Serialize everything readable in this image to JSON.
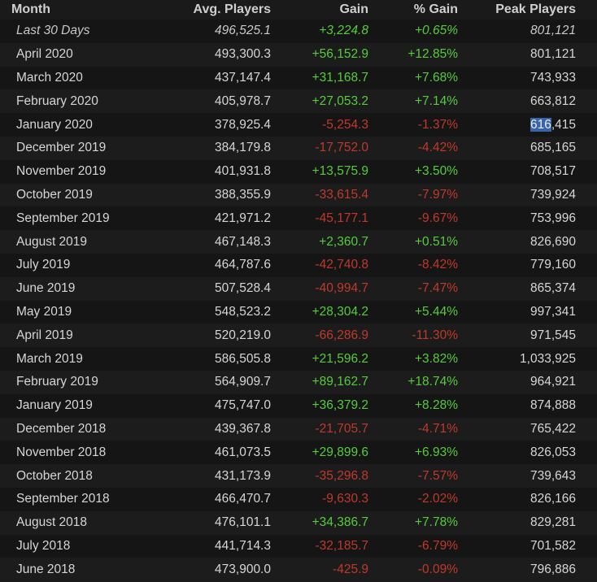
{
  "headers": {
    "month": "Month",
    "avg_players": "Avg. Players",
    "gain": "Gain",
    "pct_gain": "% Gain",
    "peak_players": "Peak Players"
  },
  "rows": [
    {
      "month": "Last 30 Days",
      "avg": "496,525.1",
      "gain": "+3,224.8",
      "pct": "+0.65%",
      "peak": "801,121",
      "trend": "pos"
    },
    {
      "month": "April 2020",
      "avg": "493,300.3",
      "gain": "+56,152.9",
      "pct": "+12.85%",
      "peak": "801,121",
      "trend": "pos"
    },
    {
      "month": "March 2020",
      "avg": "437,147.4",
      "gain": "+31,168.7",
      "pct": "+7.68%",
      "peak": "743,933",
      "trend": "pos"
    },
    {
      "month": "February 2020",
      "avg": "405,978.7",
      "gain": "+27,053.2",
      "pct": "+7.14%",
      "peak": "663,812",
      "trend": "pos"
    },
    {
      "month": "January 2020",
      "avg": "378,925.4",
      "gain": "-5,254.3",
      "pct": "-1.37%",
      "peak": "616,415",
      "trend": "neg"
    },
    {
      "month": "December 2019",
      "avg": "384,179.8",
      "gain": "-17,752.0",
      "pct": "-4.42%",
      "peak": "685,165",
      "trend": "neg"
    },
    {
      "month": "November 2019",
      "avg": "401,931.8",
      "gain": "+13,575.9",
      "pct": "+3.50%",
      "peak": "708,517",
      "trend": "pos"
    },
    {
      "month": "October 2019",
      "avg": "388,355.9",
      "gain": "-33,615.4",
      "pct": "-7.97%",
      "peak": "739,924",
      "trend": "neg"
    },
    {
      "month": "September 2019",
      "avg": "421,971.2",
      "gain": "-45,177.1",
      "pct": "-9.67%",
      "peak": "753,996",
      "trend": "neg"
    },
    {
      "month": "August 2019",
      "avg": "467,148.3",
      "gain": "+2,360.7",
      "pct": "+0.51%",
      "peak": "826,690",
      "trend": "pos"
    },
    {
      "month": "July 2019",
      "avg": "464,787.6",
      "gain": "-42,740.8",
      "pct": "-8.42%",
      "peak": "779,160",
      "trend": "neg"
    },
    {
      "month": "June 2019",
      "avg": "507,528.4",
      "gain": "-40,994.7",
      "pct": "-7.47%",
      "peak": "865,374",
      "trend": "neg"
    },
    {
      "month": "May 2019",
      "avg": "548,523.2",
      "gain": "+28,304.2",
      "pct": "+5.44%",
      "peak": "997,341",
      "trend": "pos"
    },
    {
      "month": "April 2019",
      "avg": "520,219.0",
      "gain": "-66,286.9",
      "pct": "-11.30%",
      "peak": "971,545",
      "trend": "neg"
    },
    {
      "month": "March 2019",
      "avg": "586,505.8",
      "gain": "+21,596.2",
      "pct": "+3.82%",
      "peak": "1,033,925",
      "trend": "pos"
    },
    {
      "month": "February 2019",
      "avg": "564,909.7",
      "gain": "+89,162.7",
      "pct": "+18.74%",
      "peak": "964,921",
      "trend": "pos"
    },
    {
      "month": "January 2019",
      "avg": "475,747.0",
      "gain": "+36,379.2",
      "pct": "+8.28%",
      "peak": "874,888",
      "trend": "pos"
    },
    {
      "month": "December 2018",
      "avg": "439,367.8",
      "gain": "-21,705.7",
      "pct": "-4.71%",
      "peak": "765,422",
      "trend": "neg"
    },
    {
      "month": "November 2018",
      "avg": "461,073.5",
      "gain": "+29,899.6",
      "pct": "+6.93%",
      "peak": "826,053",
      "trend": "pos"
    },
    {
      "month": "October 2018",
      "avg": "431,173.9",
      "gain": "-35,296.8",
      "pct": "-7.57%",
      "peak": "739,643",
      "trend": "neg"
    },
    {
      "month": "September 2018",
      "avg": "466,470.7",
      "gain": "-9,630.3",
      "pct": "-2.02%",
      "peak": "826,166",
      "trend": "neg"
    },
    {
      "month": "August 2018",
      "avg": "476,101.1",
      "gain": "+34,386.7",
      "pct": "+7.78%",
      "peak": "829,281",
      "trend": "pos"
    },
    {
      "month": "July 2018",
      "avg": "441,714.3",
      "gain": "-32,185.7",
      "pct": "-6.79%",
      "peak": "701,582",
      "trend": "neg"
    },
    {
      "month": "June 2018",
      "avg": "473,900.0",
      "gain": "-425.9",
      "pct": "-0.09%",
      "peak": "796,886",
      "trend": "neg"
    }
  ],
  "selection": {
    "row_index": 4,
    "selected_text": "616",
    "rest_text": ",415"
  },
  "colors": {
    "positive": "#57cb3c",
    "negative": "#c0392b",
    "selection": "#3a64a8",
    "background": "#1a1a1a"
  }
}
